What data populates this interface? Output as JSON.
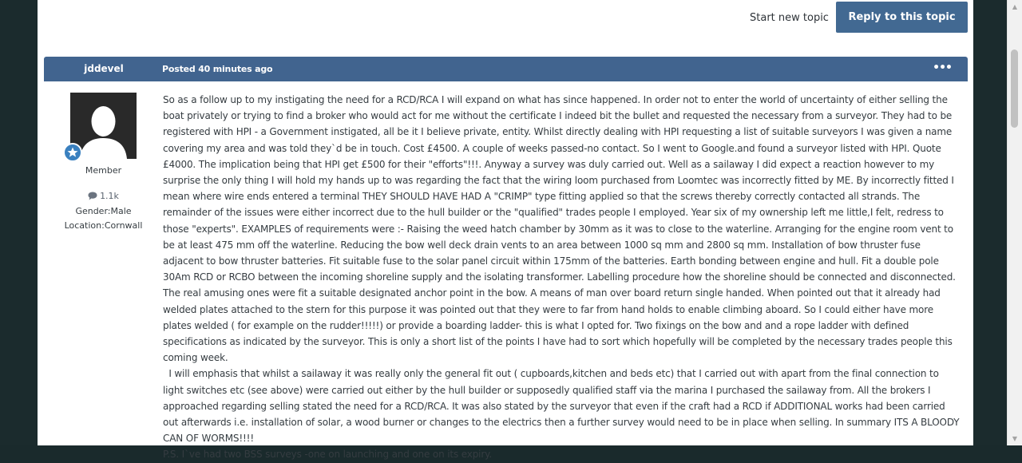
{
  "topic_actions": {
    "start_topic_label": "Start new topic",
    "reply_label": "Reply to this topic"
  },
  "post": {
    "author": "jddevel",
    "date": "Posted 40 minutes ago",
    "menu_label": "•••",
    "avatar_icon": "default-user-avatar",
    "badge_icon": "star-badge-icon",
    "member_group": "Member",
    "post_count": "1.1k",
    "gender": "Gender:Male",
    "location": "Location:Cornwall",
    "paragraph_1": "So as a follow up to my instigating the need for a RCD/RCA I will expand on what has since happened. In order not to enter the world of uncertainty of either selling the boat privately or trying to find a broker who would act for me without the certificate I indeed bit the bullet and requested the necessary from a surveyor. They had to be registered with HPI - a Government instigated, all be it I believe private, entity. Whilst directly dealing with HPI requesting a list of suitable surveyors I was given a name covering my area and was told they`d be in touch. Cost £4500. A couple of weeks passed-no contact. So I went to Google.and found a surveyor listed with HPI. Quote £4000. The implication being that HPI get £500 for their \"efforts\"!!!. Anyway a survey was duly carried out. Well as a sailaway I did expect a reaction however to my surprise the only thing I will hold my hands up to was regarding the fact that the wiring loom purchased from Loomtec was incorrectly fitted by ME. By incorrectly fitted I mean where wire ends entered a terminal THEY SHOULD HAVE HAD A \"CRIMP\" type fitting applied so that the screws thereby correctly contacted all strands. The remainder of the issues were either incorrect due to the hull builder or the \"qualified\" trades people I employed. Year six of my ownership left me little,I felt, redress to those \"experts\". EXAMPLES of requirements were :- Raising the weed hatch chamber by 30mm as it was to close to the waterline. Arranging for the engine room vent to be at least 475 mm off the waterline. Reducing the bow well deck drain vents to an area between 1000 sq mm and 2800 sq mm. Installation of bow thruster fuse adjacent to bow thruster batteries. Fit suitable fuse to the solar panel circuit within 175mm of the batteries. Earth bonding between engine and hull. Fit a double pole 30Am RCD or RCBO between the incoming shoreline supply and the isolating transformer. Labelling procedure how the shoreline should be connected and disconnected. The real amusing ones were fit a suitable designated anchor point in the bow. A means of man over board return single handed. When pointed out that it already had welded plates attached to the stern for this purpose it was pointed out that they were to far from hand holds to enable climbing aboard. So I could either have more plates welded  ( for example on the rudder!!!!!) or provide a boarding ladder- this is what I opted for. Two fixings on the bow and and a rope ladder with defined specifications as indicated by the surveyor. This is only a short list of the points I have had to sort which hopefully will be completed by the necessary trades people this coming week.",
    "paragraph_2": "  I will emphasis that whilst a sailaway it was really only the general fit out ( cupboards,kitchen and beds etc) that I carried out with apart from the final connection to light switches etc (see above) were carried out either by the hull builder or supposedly qualified staff via the marina I purchased the sailaway from. All the brokers I approached regarding selling stated the need for a RCD/RCA. It was also stated by the surveyor that even if the craft had a RCD if ADDITIONAL works had been carried out afterwards i.e. installation of solar, a wood burner or changes to the electrics then a further survey would need to be in place when selling. In summary ITS A BLOODY CAN OF WORMS!!!!",
    "paragraph_3": "P.S. I`ve had two BSS surveys -one on launching and one on its expiry."
  },
  "colors": {
    "header_bar": "#41648f",
    "reply_button": "#426992",
    "page_gutter": "#1b2b2d",
    "badge": "#3a80bf"
  }
}
